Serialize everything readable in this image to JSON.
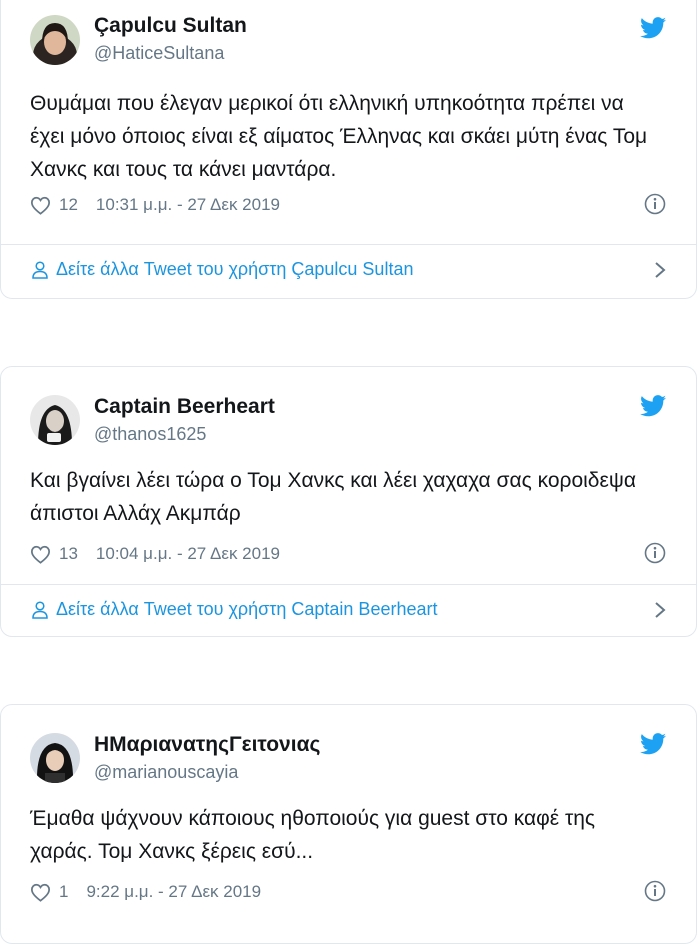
{
  "tweets": [
    {
      "name": "Çapulcu Sultan",
      "handle": "@HaticeSultana",
      "text": "Θυμάμαι που έλεγαν μερικοί ότι ελληνική υπηκοότητα πρέπει να έχει μόνο όποιος είναι εξ αίματος Έλληνας και σκάει μύτη ένας Τομ Χανκς και τους τα κάνει μαντάρα.",
      "likes": "12",
      "timestamp": "10:31 μ.μ. - 27 Δεκ 2019",
      "more_link": "Δείτε άλλα Tweet του χρήστη Çapulcu Sultan"
    },
    {
      "name": "Captain Beerheart",
      "handle": "@thanos1625",
      "text": "Και βγαίνει λέει τώρα ο Τομ Χανκς και λέει χαχαχα σας κοροιδεψα άπιστοι Αλλάχ Ακμπάρ",
      "likes": "13",
      "timestamp": "10:04 μ.μ. - 27 Δεκ 2019",
      "more_link": "Δείτε άλλα Tweet του χρήστη Captain Beerheart"
    },
    {
      "name": "ΗΜαριανατηςΓειτονιας",
      "handle": "@marianouscayia",
      "text": "Έμαθα ψάχνουν κάποιους ηθοποιούς για guest στο καφέ της χαράς. Τομ Χανκς ξέρεις εσύ...",
      "likes": "1",
      "timestamp": "9:22 μ.μ. - 27 Δεκ 2019"
    }
  ],
  "colors": {
    "twitter_blue": "#1da1f2",
    "link_blue": "#1b95e0",
    "secondary_text": "#657786",
    "border": "#e1e8ed"
  },
  "icons": [
    "twitter-bird-icon",
    "heart-icon",
    "info-icon",
    "user-icon",
    "chevron-right-icon"
  ]
}
